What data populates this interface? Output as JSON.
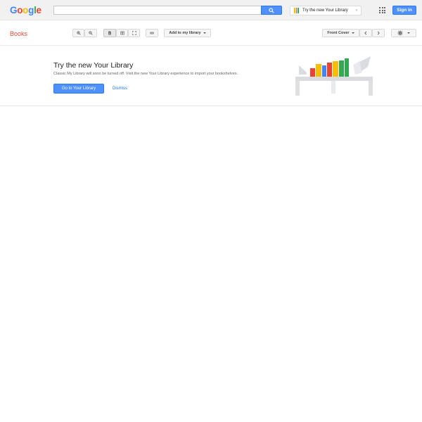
{
  "header": {
    "logo_letters": [
      {
        "ch": "G",
        "color": "#4285F4"
      },
      {
        "ch": "o",
        "color": "#EA4335"
      },
      {
        "ch": "o",
        "color": "#FBBC05"
      },
      {
        "ch": "g",
        "color": "#4285F4"
      },
      {
        "ch": "l",
        "color": "#34A853"
      },
      {
        "ch": "e",
        "color": "#EA4335"
      }
    ],
    "search": {
      "value": "",
      "placeholder": ""
    },
    "search_button_icon": "search-icon",
    "promo_chip_label": "Try the new Your Library",
    "apps_icon": "apps-grid-icon",
    "signin_label": "Sign in"
  },
  "toolbar": {
    "books_label": "Books",
    "zoom_in_icon": "zoom-in-icon",
    "zoom_out_icon": "zoom-out-icon",
    "single_page_icon": "single-page-icon",
    "two_page_icon": "two-page-icon",
    "fullscreen_icon": "fullscreen-icon",
    "link_icon": "link-icon",
    "add_to_library_label": "Add to my library",
    "page_select_label": "Front Cover",
    "prev_icon": "chevron-left-icon",
    "next_icon": "chevron-right-icon",
    "settings_icon": "gear-icon"
  },
  "promo": {
    "title": "Try the new Your Library",
    "description": "Classic My Library will soon be turned off. Visit the new Your Library experience to import your bookshelves.",
    "go_button_label": "Go to Your Library",
    "dismiss_label": "Dismiss"
  },
  "colors": {
    "accent_blue": "#4d90fe",
    "books_red": "#dd4b39",
    "book_red": "#ea4335",
    "book_yellow": "#fbbc05",
    "book_blue": "#4285f4",
    "book_green": "#34a853"
  }
}
